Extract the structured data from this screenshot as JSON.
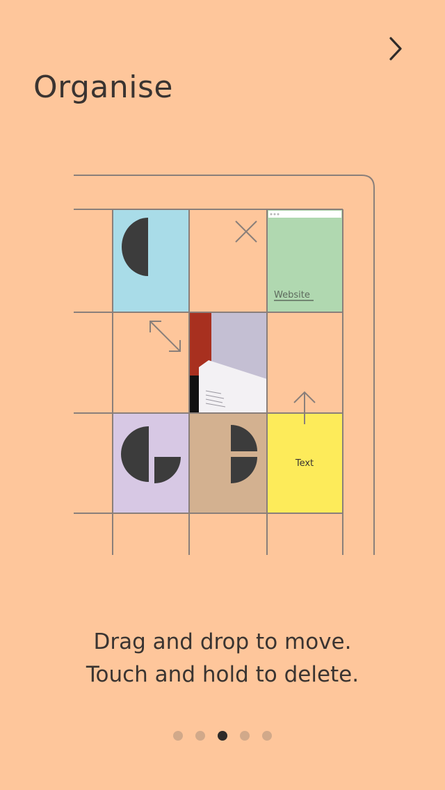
{
  "header": {
    "next_icon": "chevron-right-icon"
  },
  "title": "Organise",
  "illustration": {
    "tiles": {
      "website_label": "Website",
      "text_label": "Text"
    },
    "colors": {
      "background": "#fec69b",
      "grid_line": "#8a7f7a",
      "tile_blue": "#a9dce8",
      "tile_green": "#b0d8b0",
      "tile_lavender": "#d7c8e4",
      "tile_tan": "#d3b190",
      "tile_yellow": "#fdeb5a",
      "shape_dark": "#3c3c3c"
    },
    "icons": [
      "half-circle-icon",
      "close-icon",
      "resize-arrows-icon",
      "up-arrow-icon",
      "quarter-shapes-icon"
    ]
  },
  "caption": {
    "line1": "Drag and drop to move.",
    "line2": "Touch and hold to delete."
  },
  "pagination": {
    "count": 5,
    "active_index": 2
  }
}
